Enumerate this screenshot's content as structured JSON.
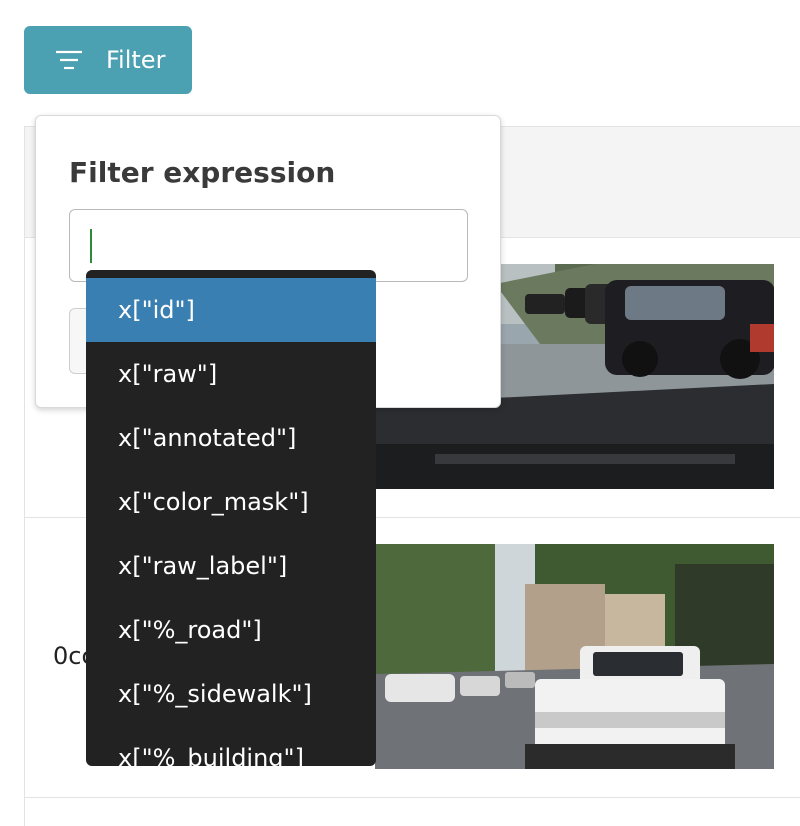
{
  "filter_button": {
    "label": "Filter",
    "icon": "filter-lines-icon",
    "color": "#4ba0b1"
  },
  "popover": {
    "title": "Filter expression",
    "input_value": ""
  },
  "dropdown": {
    "selected_index": 0,
    "items": [
      "x[\"id\"]",
      "x[\"raw\"]",
      "x[\"annotated\"]",
      "x[\"color_mask\"]",
      "x[\"raw_label\"]",
      "x[\"%_road\"]",
      "x[\"%_sidewalk\"]",
      "x[\"%_building\"]"
    ],
    "selected_color": "#3a7fb2"
  },
  "table": {
    "row2_id_partial": "0cc"
  }
}
